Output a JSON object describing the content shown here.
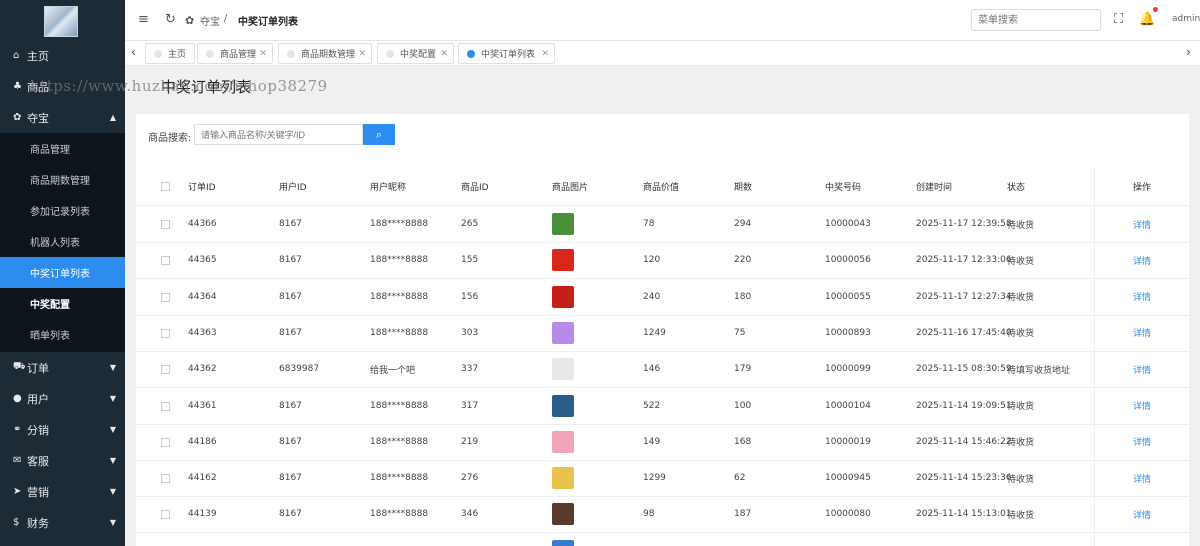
{
  "sidebar": {
    "menu": [
      {
        "icon": "home-icon",
        "label": "主页",
        "glyph": "⌂"
      },
      {
        "icon": "shop-icon",
        "label": "商品",
        "glyph": "♣"
      },
      {
        "icon": "treasure-icon",
        "label": "夺宝",
        "glyph": "✿"
      }
    ],
    "submenu": [
      {
        "label": "商品管理"
      },
      {
        "label": "商品期数管理"
      },
      {
        "label": "参加记录列表"
      },
      {
        "label": "机器人列表"
      },
      {
        "label": "中奖订单列表"
      },
      {
        "label": "中奖配置"
      },
      {
        "label": "晒单列表"
      }
    ],
    "menu_bottom": [
      {
        "icon": "cart-icon",
        "label": "订单",
        "glyph": "⛟"
      },
      {
        "icon": "user-icon",
        "label": "用户",
        "glyph": "●"
      },
      {
        "icon": "share-icon",
        "label": "分销",
        "glyph": "⚭"
      },
      {
        "icon": "service-icon",
        "label": "客服",
        "glyph": "✉"
      },
      {
        "icon": "marketing-icon",
        "label": "营销",
        "glyph": "➤"
      },
      {
        "icon": "finance-icon",
        "label": "财务",
        "glyph": "$"
      }
    ]
  },
  "topbar": {
    "crumb_root": "夺宝",
    "crumb_sep": "/",
    "crumb_current": "中奖订单列表",
    "search_placeholder": "菜单搜索",
    "user": "admin"
  },
  "tabs": [
    {
      "label": "主页"
    },
    {
      "label": "商品管理"
    },
    {
      "label": "商品期数管理"
    },
    {
      "label": "中奖配置"
    },
    {
      "label": "中奖订单列表"
    }
  ],
  "page": {
    "title": "中奖订单列表",
    "watermark": "https://www.huzhan.com/ishop38279"
  },
  "search": {
    "label": "商品搜索:",
    "placeholder": "请输入商品名称/关键字/ID"
  },
  "table": {
    "columns": [
      "订单ID",
      "用户ID",
      "用户昵称",
      "商品ID",
      "商品图片",
      "商品价值",
      "期数",
      "中奖号码",
      "创建时间",
      "状态",
      "操作"
    ],
    "rows": [
      {
        "order_id": "44366",
        "user_id": "8167",
        "nickname": "188****8888",
        "goods_id": "265",
        "price": "78",
        "period": "294",
        "number": "10000043",
        "time": "2025-11-17 12:39:58",
        "status": "待收货",
        "action": "详情",
        "thumb": "#4a8f3a"
      },
      {
        "order_id": "44365",
        "user_id": "8167",
        "nickname": "188****8888",
        "goods_id": "155",
        "price": "120",
        "period": "220",
        "number": "10000056",
        "time": "2025-11-17 12:33:06",
        "status": "待收货",
        "action": "详情",
        "thumb": "#d8281e"
      },
      {
        "order_id": "44364",
        "user_id": "8167",
        "nickname": "188****8888",
        "goods_id": "156",
        "price": "240",
        "period": "180",
        "number": "10000055",
        "time": "2025-11-17 12:27:34",
        "status": "待收货",
        "action": "详情",
        "thumb": "#c41f1a"
      },
      {
        "order_id": "44363",
        "user_id": "8167",
        "nickname": "188****8888",
        "goods_id": "303",
        "price": "1249",
        "period": "75",
        "number": "10000893",
        "time": "2025-11-16 17:45:40",
        "status": "待收货",
        "action": "详情",
        "thumb": "#b88be8"
      },
      {
        "order_id": "44362",
        "user_id": "6839987",
        "nickname": "给我一个吧",
        "goods_id": "337",
        "price": "146",
        "period": "179",
        "number": "10000099",
        "time": "2025-11-15 08:30:59",
        "status": "待填写收货地址",
        "action": "详情",
        "thumb": "#e8e8e8"
      },
      {
        "order_id": "44361",
        "user_id": "8167",
        "nickname": "188****8888",
        "goods_id": "317",
        "price": "522",
        "period": "100",
        "number": "10000104",
        "time": "2025-11-14 19:09:51",
        "status": "待收货",
        "action": "详情",
        "thumb": "#2a5d8a"
      },
      {
        "order_id": "44186",
        "user_id": "8167",
        "nickname": "188****8888",
        "goods_id": "219",
        "price": "149",
        "period": "168",
        "number": "10000019",
        "time": "2025-11-14 15:46:22",
        "status": "待收货",
        "action": "详情",
        "thumb": "#f0a4b8"
      },
      {
        "order_id": "44162",
        "user_id": "8167",
        "nickname": "188****8888",
        "goods_id": "276",
        "price": "1299",
        "period": "62",
        "number": "10000945",
        "time": "2025-11-14 15:23:36",
        "status": "待收货",
        "action": "详情",
        "thumb": "#e8c24a"
      },
      {
        "order_id": "44139",
        "user_id": "8167",
        "nickname": "188****8888",
        "goods_id": "346",
        "price": "98",
        "period": "187",
        "number": "10000080",
        "time": "2025-11-14 15:13:01",
        "status": "待收货",
        "action": "详情",
        "thumb": "#5a3a2a"
      },
      {
        "order_id": "",
        "user_id": "",
        "nickname": "",
        "goods_id": "",
        "price": "",
        "period": "",
        "number": "",
        "time": "",
        "status": "",
        "action": "",
        "thumb": "#3a7ad0"
      }
    ]
  }
}
